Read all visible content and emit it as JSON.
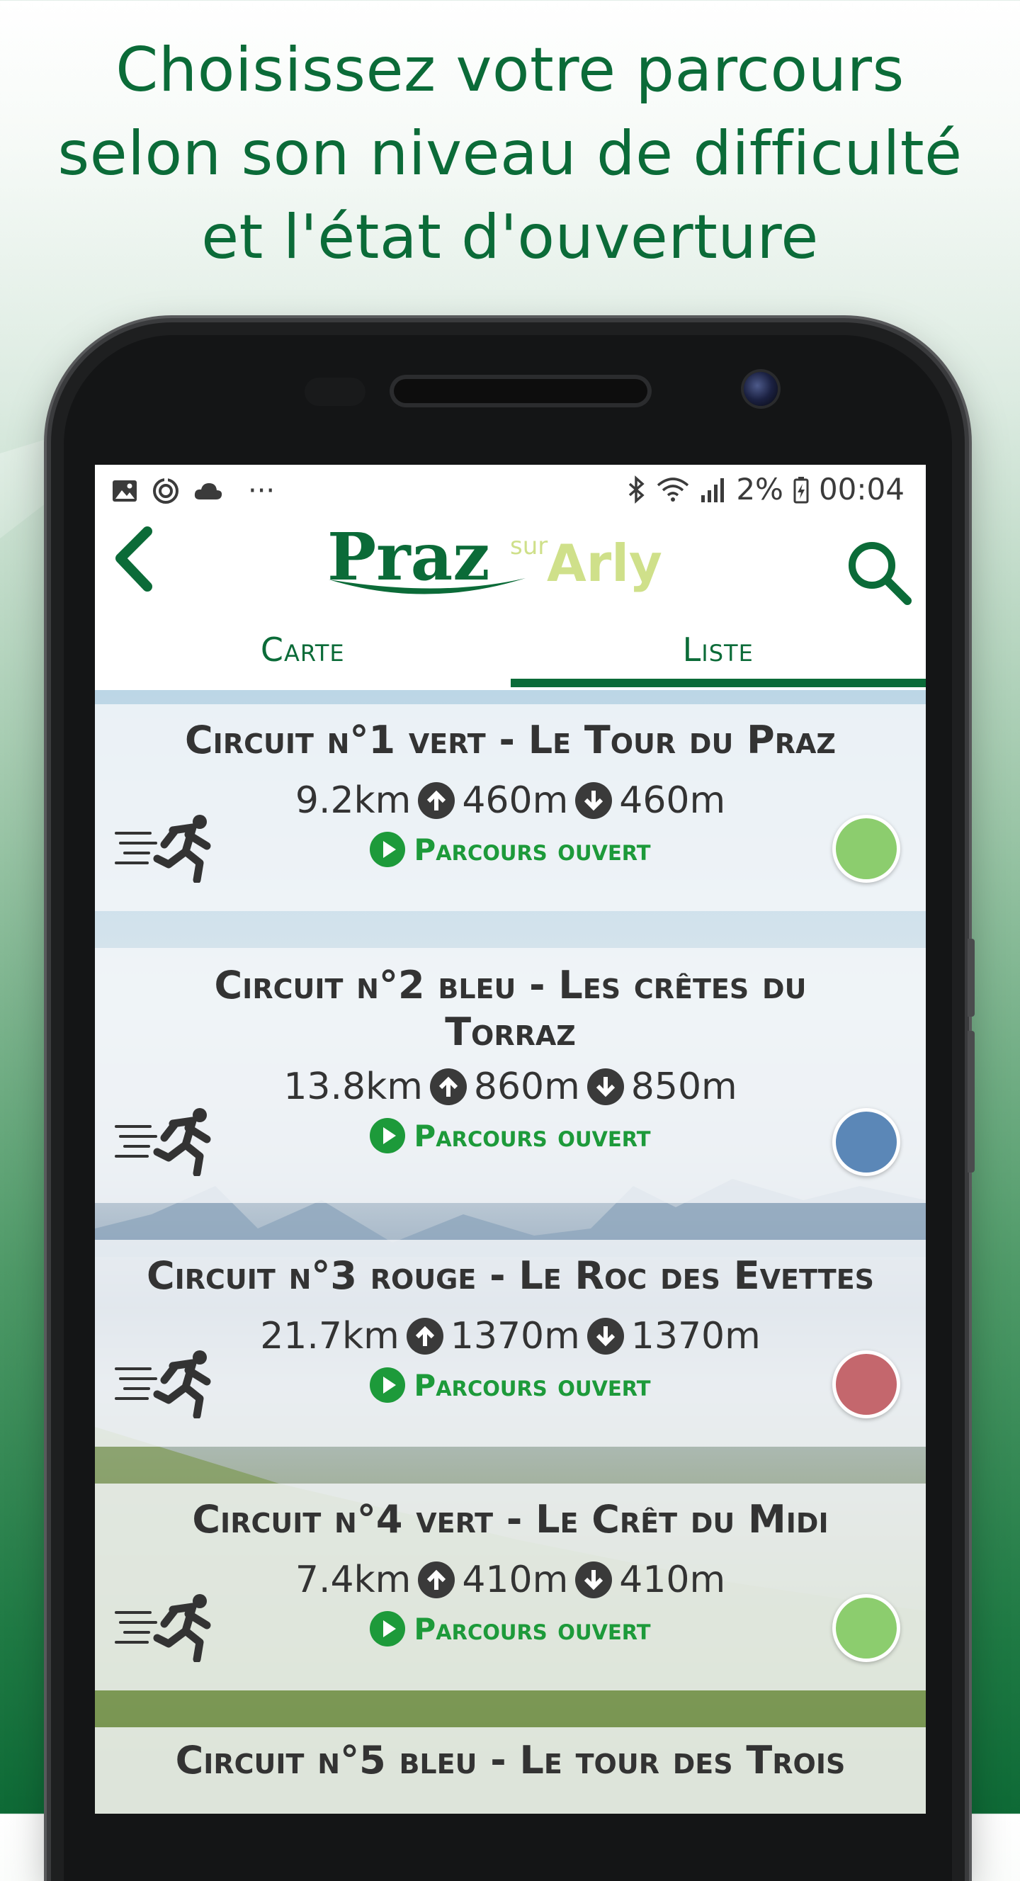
{
  "headline": {
    "line1": "Choisissez votre parcours",
    "line2": "selon son niveau de difficulté",
    "line3": "et l'état d'ouverture"
  },
  "statusbar": {
    "left_icons": [
      "image-icon",
      "sync-icon",
      "cloud-icon",
      "more-icon"
    ],
    "more_text": "···",
    "right_icons": [
      "bluetooth-icon",
      "wifi-icon",
      "signal-icon",
      "battery-icon"
    ],
    "battery": "2%",
    "time": "00:04"
  },
  "appbar": {
    "logo_main": "Praz",
    "logo_sup": "sur",
    "logo_sub": "Arly",
    "back_icon": "chevron-left-icon",
    "search_icon": "search-icon"
  },
  "tabs": [
    {
      "label": "Carte",
      "active": false
    },
    {
      "label": "Liste",
      "active": true
    }
  ],
  "circuits": [
    {
      "title": "Circuit n°1 vert - Le Tour du Praz",
      "distance": "9.2km",
      "up": "460m",
      "down": "460m",
      "status": "Parcours ouvert",
      "color": "#8ccd6e"
    },
    {
      "title": "Circuit n°2 bleu - Les crêtes du Torraz",
      "distance": "13.8km",
      "up": "860m",
      "down": "850m",
      "status": "Parcours ouvert",
      "color": "#5b87b7"
    },
    {
      "title": "Circuit n°3 rouge - Le Roc des Evettes",
      "distance": "21.7km",
      "up": "1370m",
      "down": "1370m",
      "status": "Parcours ouvert",
      "color": "#c4676d"
    },
    {
      "title": "Circuit n°4 vert - Le Crêt du Midi",
      "distance": "7.4km",
      "up": "410m",
      "down": "410m",
      "status": "Parcours ouvert",
      "color": "#8ccd6e"
    },
    {
      "title": "Circuit n°5 bleu - Le tour des Trois",
      "distance": "",
      "up": "",
      "down": "",
      "status": "",
      "color": "#5b87b7"
    }
  ],
  "colors": {
    "brand_green": "#0b6b38",
    "status_green": "#1d9a3a",
    "logo_light_green": "#cfe08a"
  }
}
